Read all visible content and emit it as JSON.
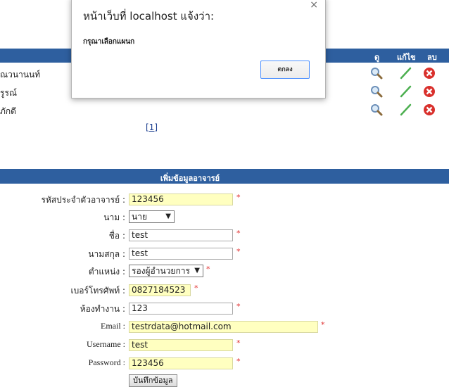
{
  "list": {
    "columns": {
      "view": "ดู",
      "edit": "แก้ไข",
      "delete": "ลบ"
    },
    "rows": [
      {
        "name": "ณวนานนท์"
      },
      {
        "name": "รูรณ์"
      },
      {
        "name": "ภักดี"
      }
    ],
    "pager": "[1]",
    "icons": {
      "view": "magnifier-icon",
      "edit": "pencil-icon",
      "delete": "delete-x-icon"
    },
    "colors": {
      "header": "#2e5f9f",
      "edit": "#4caf50",
      "delete": "#d9302c"
    }
  },
  "form": {
    "title": "เพิ่มข้อมูลอาจารย์",
    "fields": {
      "teacher_id": {
        "label": "รหัสประจำตัวอาจารย์ :",
        "value": "123456"
      },
      "prefix": {
        "label": "นาม :",
        "value": "นาย"
      },
      "first_name": {
        "label": "ชื่อ :",
        "value": "test"
      },
      "last_name": {
        "label": "นามสกุล :",
        "value": "test"
      },
      "position": {
        "label": "ตำแหน่ง :",
        "value": "รองผู้อำนวยการ"
      },
      "phone": {
        "label": "เบอร์โทรศัพท์ :",
        "value": "0827184523"
      },
      "room": {
        "label": "ห้องทำงาน :",
        "value": "123"
      },
      "email": {
        "label": "Email :",
        "value": "testrdata@hotmail.com"
      },
      "username": {
        "label": "Username :",
        "value": "test"
      },
      "password": {
        "label": "Password :",
        "value": "123456"
      }
    },
    "required_mark": "*",
    "save_label": "บันทึกข้อมูล"
  },
  "dialog": {
    "title": "หน้าเว็บที่ localhost แจ้งว่า:",
    "message": "กรุณาเลือกแผนก",
    "ok_label": "ตกลง",
    "close_label": "×"
  }
}
